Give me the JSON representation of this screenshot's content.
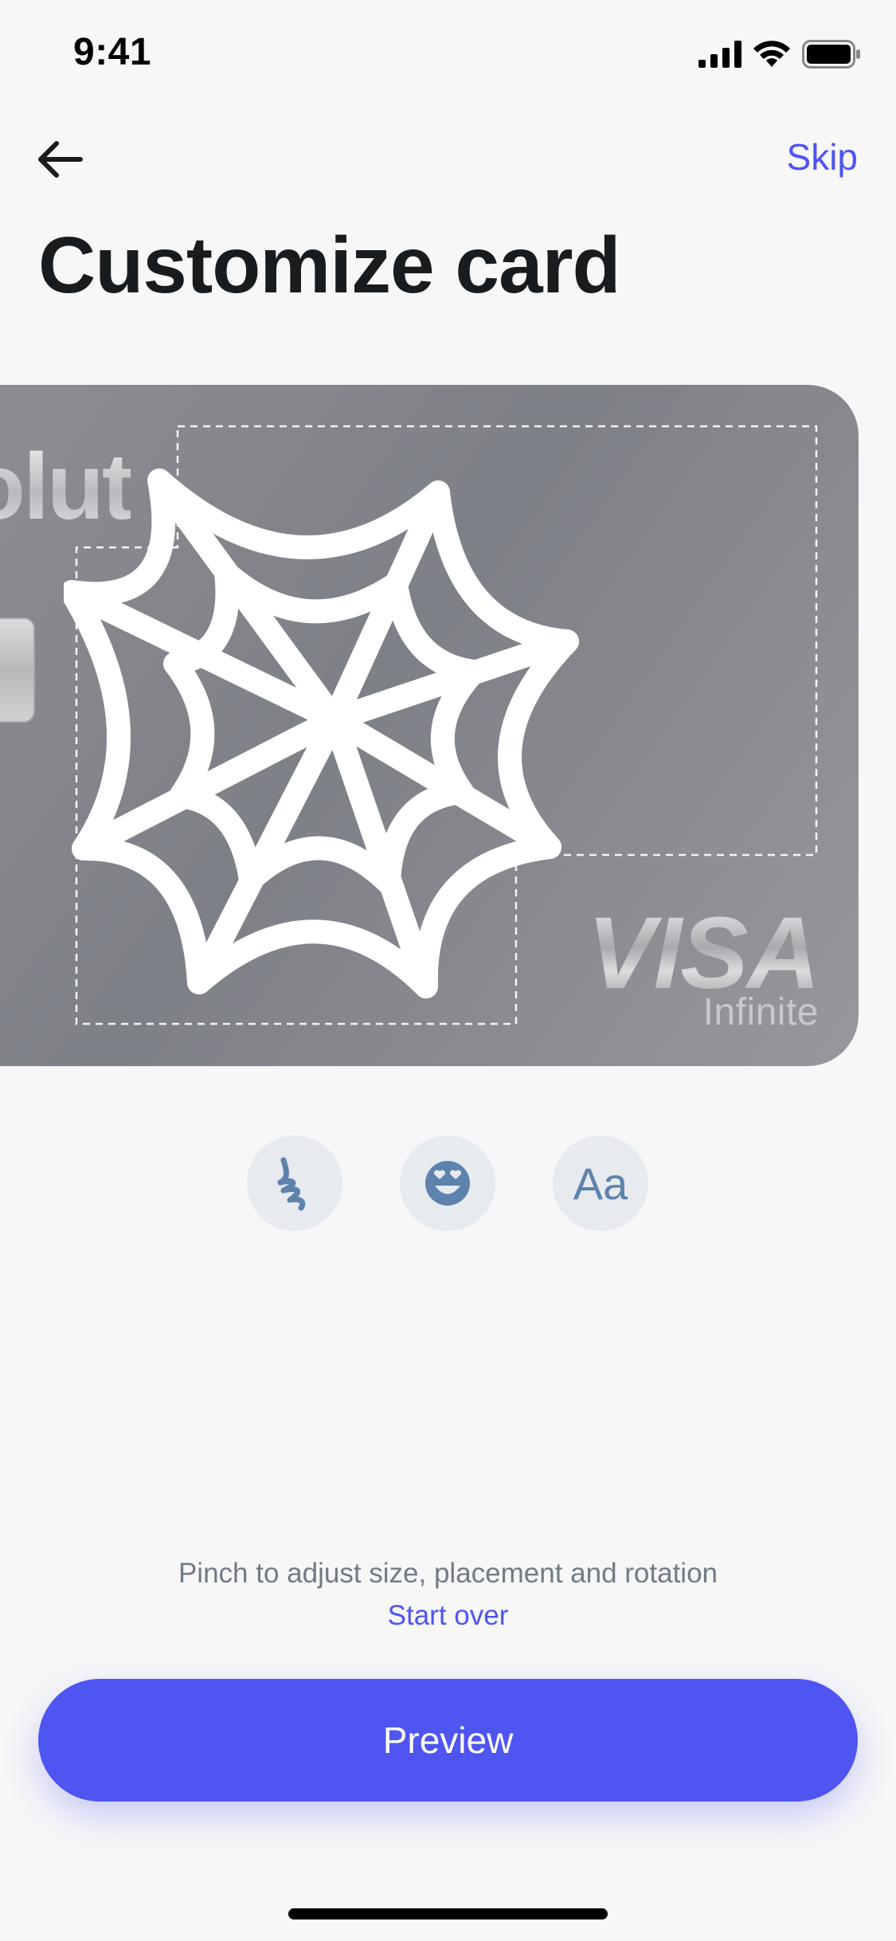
{
  "status_bar": {
    "time": "9:41",
    "icons": [
      "cellular-signal-icon",
      "wifi-icon",
      "battery-icon"
    ]
  },
  "nav": {
    "back_icon": "arrow-left-icon",
    "skip_label": "Skip"
  },
  "title": "Customize card",
  "card": {
    "brand_text": "olut",
    "sticker_icon": "spider-web-icon",
    "network": "VISA",
    "tier": "Infinite"
  },
  "tools": [
    {
      "name": "draw",
      "icon": "doodle-icon"
    },
    {
      "name": "sticker",
      "icon": "heart-eyes-emoji-icon"
    },
    {
      "name": "text",
      "label": "Aa"
    }
  ],
  "hint_text": "Pinch to adjust size, placement and rotation",
  "start_over_label": "Start over",
  "primary_button_label": "Preview",
  "colors": {
    "accent": "#4F55F1",
    "background": "#F7F7F8",
    "card": "#8A8B90",
    "tool_bg": "#E7EAEF",
    "tool_icon": "#5D82AD",
    "hint": "#717A85"
  }
}
